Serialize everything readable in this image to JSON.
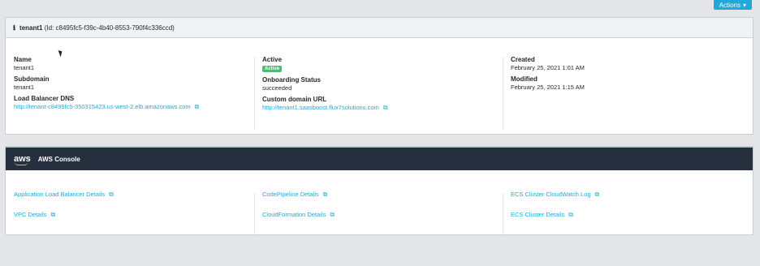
{
  "toolbar": {
    "actions_label": "Actions"
  },
  "tenant_card": {
    "name_bold": "tenant1",
    "id_text": "(Id: c8495fc5-f39c-4b40-8553-790f4c336ccd)",
    "col1": {
      "name_label": "Name",
      "name_value": "tenant1",
      "subdomain_label": "Subdomain",
      "subdomain_value": "tenant1",
      "lb_label": "Load Balancer DNS",
      "lb_value": "http://tenant-c8495fc5-350315423.us-west-2.elb.amazonaws.com"
    },
    "col2": {
      "active_label": "Active",
      "active_badge": "Active",
      "onboarding_label": "Onboarding Status",
      "onboarding_value": "succeeded",
      "domain_label": "Custom domain URL",
      "domain_value": "http://tenant1.saasboost.flux7solutions.com"
    },
    "col3": {
      "created_label": "Created",
      "created_value": "February 25, 2021 1:01 AM",
      "modified_label": "Modified",
      "modified_value": "February 25, 2021 1:15 AM"
    }
  },
  "console_card": {
    "logo_text": "aws",
    "title": "AWS Console",
    "links": {
      "alb": "Application Load Balancer Details",
      "vpc": "VPC Details",
      "codepipeline": "CodePipeline Details",
      "cloudformation": "CloudFormation Details",
      "ecs_log": "ECS Cluster CloudWatch Log",
      "ecs": "ECS Cluster Details"
    }
  },
  "colors": {
    "accent": "#20a8d8",
    "success": "#4dbd74",
    "aws_dark": "#252f3e",
    "aws_orange": "#f0a44b"
  }
}
